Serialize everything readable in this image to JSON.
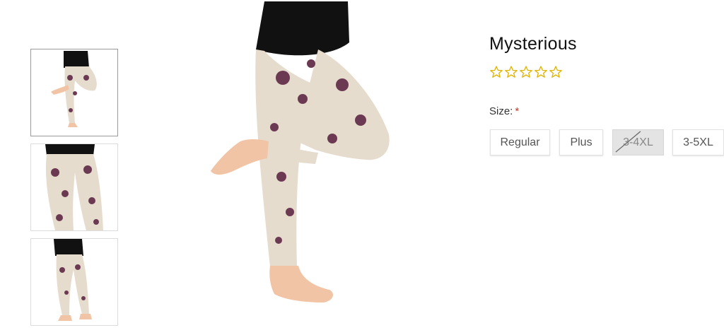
{
  "product": {
    "title": "Mysterious",
    "rating": {
      "filled": 0,
      "max": 5,
      "star_color": "#e0b400"
    }
  },
  "size": {
    "label": "Size:",
    "required_mark": "*",
    "options": [
      {
        "label": "Regular",
        "available": true
      },
      {
        "label": "Plus",
        "available": true
      },
      {
        "label": "3-4XL",
        "available": false
      },
      {
        "label": "3-5XL",
        "available": true
      }
    ]
  },
  "gallery": {
    "active_index": 0,
    "thumbnail_count": 3
  },
  "colors": {
    "legging_base": "#e6dccd",
    "legging_print": "#6b3a52",
    "top": "#111111",
    "skin": "#f2c4a6"
  }
}
